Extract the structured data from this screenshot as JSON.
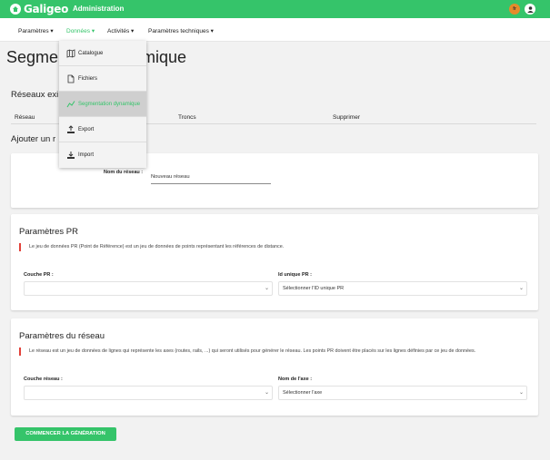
{
  "header": {
    "logo": "Galigeo",
    "title": "Administration",
    "flag_badge": "fr"
  },
  "menu": {
    "items": [
      {
        "label": "Paramètres ▾"
      },
      {
        "label": "Données ▾"
      },
      {
        "label": "Activités ▾"
      },
      {
        "label": "Paramètres techniques ▾"
      }
    ]
  },
  "dropdown": {
    "items": [
      {
        "label": "Catalogue",
        "icon": "map-icon"
      },
      {
        "label": "Fichiers",
        "icon": "file-icon"
      },
      {
        "label": "Segmentation dynamique",
        "icon": "line-chart-icon"
      },
      {
        "label": "Export",
        "icon": "export-icon"
      },
      {
        "label": "Import",
        "icon": "import-icon"
      }
    ]
  },
  "page": {
    "title_left": "Segmen",
    "title_right": "mique",
    "existing_heading": "Réseaux exi",
    "add_heading": "Ajouter un r"
  },
  "table": {
    "columns": [
      "Réseau",
      "Troncs",
      "Supprimer"
    ]
  },
  "network_form": {
    "name_label": "Nom du réseau :",
    "name_value": "Nouveau réseau"
  },
  "pr": {
    "heading": "Paramètres PR",
    "note": "Le jeu de données PR (Point de Référence) est un jeu de données de points représentant les références de distance.",
    "layer_label": "Couche PR :",
    "layer_value": "",
    "id_label": "Id unique PR :",
    "id_value": "Sélectionner l'ID unique PR"
  },
  "network": {
    "heading": "Paramètres du réseau",
    "note": "Le réseau est un jeu de données de lignes qui représente les axes (routes, rails, ...) qui seront utilisés pour générer le réseau. Les points PR doivent être placés sur les lignes définies par ce jeu de données.",
    "layer_label": "Couche réseau :",
    "layer_value": "",
    "axis_label": "Nom de l'axe :",
    "axis_value": "Sélectionner l'axe"
  },
  "actions": {
    "start_label": "COMMENCER LA GÉNÉRATION"
  },
  "colors": {
    "brand": "#35c46a",
    "alert": "#e2413a"
  }
}
